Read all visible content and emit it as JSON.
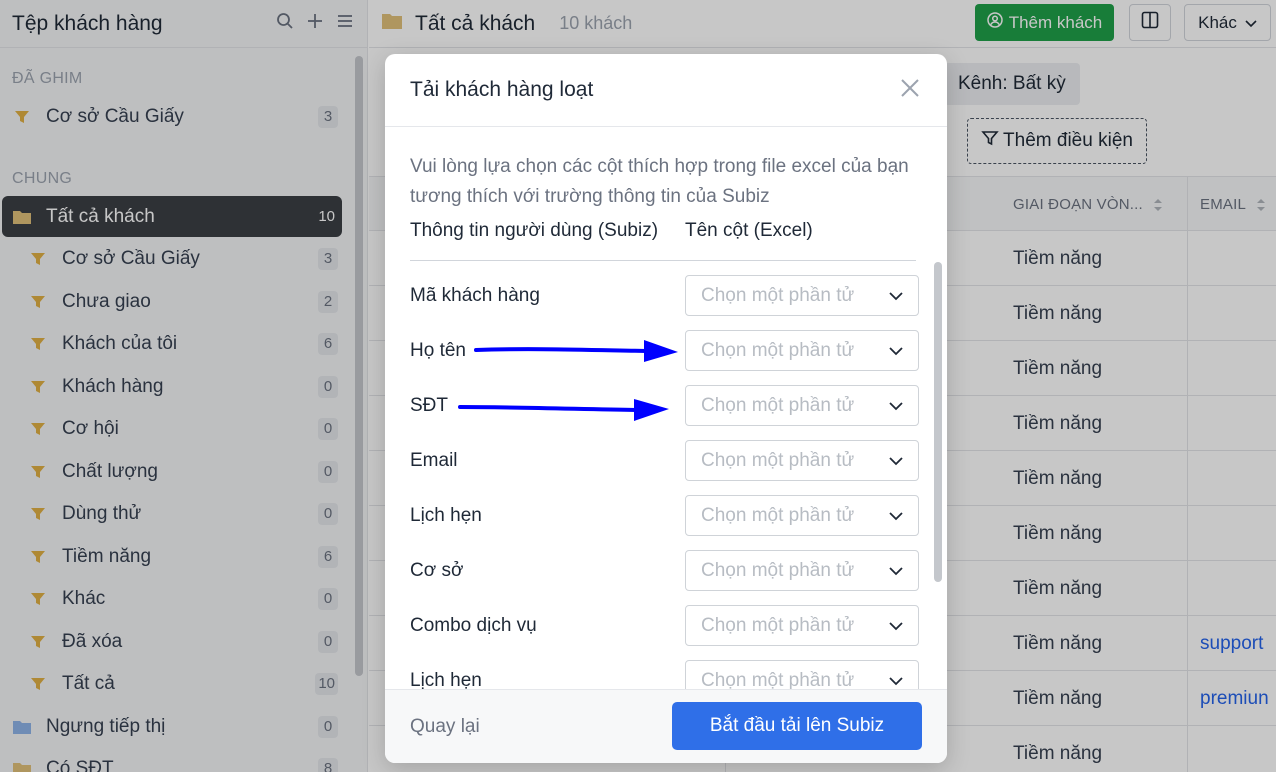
{
  "sidebar": {
    "title": "Tệp khách hàng",
    "sections": {
      "pinned": "ĐÃ GHIM",
      "general": "CHUNG"
    },
    "pinned": [
      {
        "label": "Cơ sở Cầu Giấy",
        "count": "3"
      }
    ],
    "items": [
      {
        "label": "Tất cả khách",
        "count": "10"
      },
      {
        "label": "Cơ sở Cầu Giấy",
        "count": "3"
      },
      {
        "label": "Chưa giao",
        "count": "2"
      },
      {
        "label": "Khách của tôi",
        "count": "6"
      },
      {
        "label": "Khách hàng",
        "count": "0"
      },
      {
        "label": "Cơ hội",
        "count": "0"
      },
      {
        "label": "Chất lượng",
        "count": "0"
      },
      {
        "label": "Dùng thử",
        "count": "0"
      },
      {
        "label": "Tiềm năng",
        "count": "6"
      },
      {
        "label": "Khác",
        "count": "0"
      },
      {
        "label": "Đã xóa",
        "count": "0"
      },
      {
        "label": "Tất cả",
        "count": "10"
      },
      {
        "label": "Ngưng tiếp thị",
        "count": "0"
      },
      {
        "label": "Có SĐT",
        "count": "8"
      }
    ]
  },
  "header": {
    "title": "Tất cả khách",
    "count": "10 khách",
    "add_label": "Thêm khách",
    "more_label": "Khác"
  },
  "filters": {
    "channel": "Kênh: Bất kỳ",
    "add_condition": "Thêm điều kiện"
  },
  "table": {
    "headers": {
      "stage": "GIAI ĐOẠN VÒN...",
      "email": "EMAIL"
    },
    "rows": [
      {
        "stage": "Tiềm năng",
        "email": ""
      },
      {
        "stage": "Tiềm năng",
        "email": ""
      },
      {
        "stage": "Tiềm năng",
        "email": ""
      },
      {
        "stage": "Tiềm năng",
        "email": ""
      },
      {
        "stage": "Tiềm năng",
        "email": ""
      },
      {
        "stage": "Tiềm năng",
        "email": ""
      },
      {
        "stage": "Tiềm năng",
        "email": ""
      },
      {
        "stage": "Tiềm năng",
        "email": "support"
      },
      {
        "stage": "Tiềm năng",
        "email": "premiun"
      },
      {
        "stage": "Tiềm năng",
        "email": ""
      }
    ]
  },
  "modal": {
    "title": "Tải khách hàng loạt",
    "description": "Vui lòng lựa chọn các cột thích hợp trong file excel của bạn tương thích với trường thông tin của Subiz",
    "col_user": "Thông tin người dùng (Subiz)",
    "col_excel": "Tên cột (Excel)",
    "placeholder": "Chọn một phần tử",
    "fields": [
      {
        "label": "Mã khách hàng"
      },
      {
        "label": "Họ tên"
      },
      {
        "label": "SĐT"
      },
      {
        "label": "Email"
      },
      {
        "label": "Lịch hẹn"
      },
      {
        "label": "Cơ sở"
      },
      {
        "label": "Combo dịch vụ"
      },
      {
        "label": "Lịch hẹn"
      }
    ],
    "back_label": "Quay lại",
    "submit_label": "Bắt đầu tải lên Subiz"
  },
  "colors": {
    "primary": "#2f6fe8",
    "success": "#1fa14a",
    "annotation_arrow": "#0000ff",
    "sidebar_active": "#3b3f45"
  }
}
